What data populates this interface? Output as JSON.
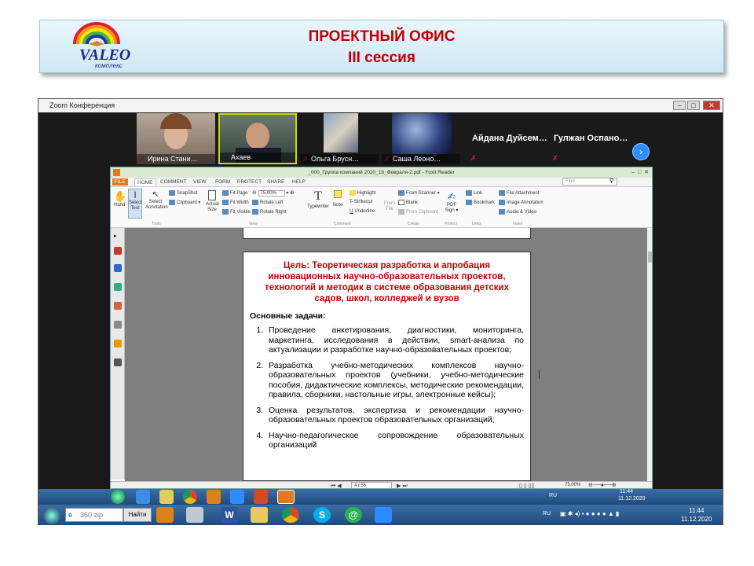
{
  "slide": {
    "title_line1": "ПРОЕКТНЫЙ ОФИС",
    "title_line2": "III сессия",
    "logo_main": "VALEO",
    "logo_sub": "комплекс"
  },
  "zoom": {
    "window_title": "Zoom Конференция",
    "participants": [
      {
        "name": "Ирина Стани…"
      },
      {
        "name": "Ахаев"
      },
      {
        "name": "Ольга Бруcн…"
      },
      {
        "name": "Саша Леоно…"
      },
      {
        "name": "Айдана Дуйсем…"
      },
      {
        "name": "Гулжан Оспано…"
      }
    ]
  },
  "foxit": {
    "title": "_000_Группа компаний 2020_18_Февраля-2.pdf - Foxit Reader",
    "tabs": [
      "FILE",
      "HOME",
      "COMMENT",
      "VIEW",
      "FORM",
      "PROTECT",
      "SHARE",
      "HELP"
    ],
    "search_placeholder": "Find",
    "ribbon": {
      "hand": "Hand",
      "select_text": "Select Text",
      "select_annotation": "Select Annotation",
      "snapshot": "SnapShot",
      "clipboard": "Clipboard",
      "actual_size": "Actual Size",
      "fit_page": "Fit Page",
      "fit_width": "Fit Width",
      "fit_visible": "Fit Visible",
      "zoom_value": "75.00%",
      "rotate_left": "Rotate Left",
      "rotate_right": "Rotate Right",
      "typewriter": "Typewriter",
      "note": "Note",
      "highlight": "Highlight",
      "strikeout": "Strikeout",
      "underline": "Underline",
      "from_file": "From File",
      "from_scanner": "From Scanner",
      "blank": "Blank",
      "from_clipboard": "From Clipboard",
      "pdf_sign": "PDF Sign",
      "link": "Link",
      "bookmark": "Bookmark",
      "file_attachment": "File Attachment",
      "image_annotation": "Image Annotation",
      "audio_video": "Audio & Video",
      "groups": [
        "Tools",
        "View",
        "Comment",
        "Create",
        "Protect",
        "Links",
        "Insert"
      ]
    },
    "document": {
      "goal": "Цель: Теоретическая разработка и апробация инновационных научно-образовательных проектов, технологий и методик в системе образования детских садов, школ, колледжей и вузов",
      "tasks_heading": "Основные задачи:",
      "tasks": [
        "Проведение анкетирования, диагностики, мониторинга, маркетинга, исследования в действии, smart-анализа по актуализации и разработке научно-образовательных проектов;",
        "Разработка учебно-методических комплексов научно-образовательных проектов (учебники, учебно-методические пособия, дидактические комплексы, методические рекомендации, правила, сборники, настольные игры, электронные кейсы);",
        "Оценка результатов, экспертиза и рекомендации научно-образовательных проектов образовательных организаций;",
        "Научно-педагогическое сопровождение образовательных организаций"
      ]
    },
    "status": {
      "page": "4 / 55",
      "zoom": "75.00%"
    }
  },
  "inner_taskbar": {
    "lang": "RU",
    "time": "11:44",
    "date": "11.12.2020"
  },
  "outer_taskbar": {
    "search_label": "360 zip",
    "search_button": "Найти",
    "lang": "RU",
    "time": "11:44",
    "date": "11.12.2020"
  }
}
